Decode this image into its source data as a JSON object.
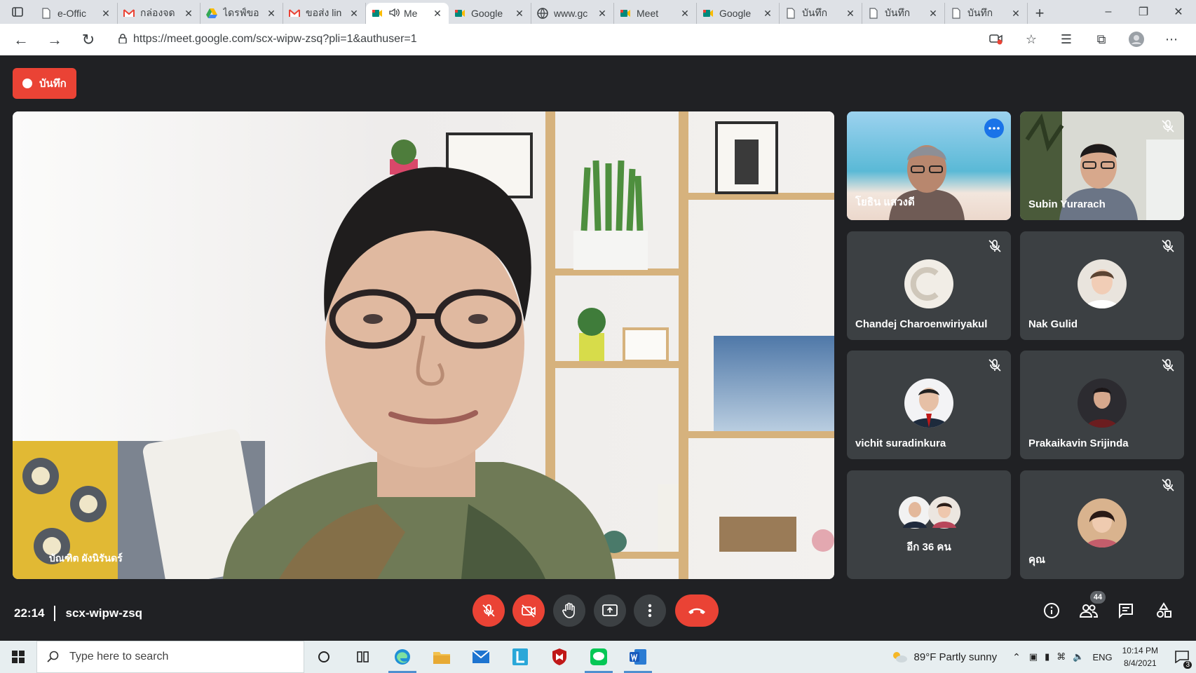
{
  "browser": {
    "tabs": [
      {
        "title": "e-Offic",
        "icon": "file-icon"
      },
      {
        "title": "กล่องจด",
        "icon": "gmail-icon"
      },
      {
        "title": "ไดรฟ์ขอ",
        "icon": "drive-icon"
      },
      {
        "title": "ขอส่ง lin",
        "icon": "gmail-icon"
      },
      {
        "title": "Me",
        "icon": "meet-icon",
        "active": true
      },
      {
        "title": "Google",
        "icon": "meet-icon"
      },
      {
        "title": "www.gc",
        "icon": "web-icon"
      },
      {
        "title": "Meet",
        "icon": "meet-icon"
      },
      {
        "title": "Google",
        "icon": "meet-icon"
      },
      {
        "title": "บันทึก",
        "icon": "file-icon"
      },
      {
        "title": "บันทึก",
        "icon": "file-icon"
      },
      {
        "title": "บันทึก",
        "icon": "file-icon"
      }
    ],
    "close_glyph": "✕",
    "new_tab_glyph": "+",
    "url": "https://meet.google.com/scx-wipw-zsq?pli=1&authuser=1"
  },
  "meet": {
    "record_label": "บันทึก",
    "main_speaker_name": "บัณฑิต ผังนิรันดร์",
    "tiles": [
      {
        "name": "โยธิน แสวงดี",
        "type": "video",
        "highlight": true,
        "muted": false
      },
      {
        "name": "Subin Yurarach",
        "type": "video",
        "muted": true
      },
      {
        "name": "Chandej Charoenwiriyakul",
        "type": "avatar",
        "initial": "C",
        "muted": true
      },
      {
        "name": "Nak Gulid",
        "type": "avatar",
        "muted": true
      },
      {
        "name": "vichit suradinkura",
        "type": "avatar",
        "muted": true
      },
      {
        "name": "Prakaikavin Srijinda",
        "type": "avatar",
        "muted": true
      },
      {
        "name": "อีก 36 คน",
        "type": "others",
        "muted": false
      },
      {
        "name": "คุณ",
        "type": "avatar",
        "muted": true
      }
    ],
    "time": "22:14",
    "meeting_code": "scx-wipw-zsq",
    "participants_count": "44"
  },
  "taskbar": {
    "search_placeholder": "Type here to search",
    "weather": "89°F  Partly sunny",
    "language": "ENG",
    "time": "10:14 PM",
    "date": "8/4/2021",
    "notification_count": "3"
  },
  "colors": {
    "meet_bg": "#202124",
    "tile_bg": "#3c4043",
    "red": "#ea4335",
    "highlight_border": "#8ab4f8"
  }
}
